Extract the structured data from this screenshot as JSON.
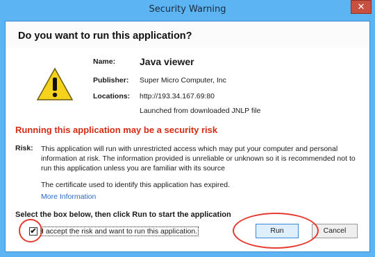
{
  "window": {
    "title": "Security Warning",
    "close_glyph": "✕"
  },
  "dialog": {
    "question": "Do you want to run this application?",
    "icon": "warning-triangle-icon",
    "fields": {
      "name_label": "Name:",
      "name_value": "Java viewer",
      "publisher_label": "Publisher:",
      "publisher_value": "Super Micro Computer, Inc",
      "locations_label": "Locations:",
      "locations_value": "http://193.34.167.69:80",
      "locations_note": "Launched from downloaded JNLP file"
    },
    "risk_heading": "Running this application may be a security risk",
    "risk_label": "Risk:",
    "risk_text": "This application will run with unrestricted access which may put your computer and personal information at risk. The information provided is unreliable or unknown so it is recommended not to run this application unless you are familiar with its source",
    "cert_text": "The certificate used to identify this application has expired.",
    "more_info": "More Information",
    "instruction": "Select the box below, then click Run to start the application",
    "accept_label": "I accept the risk and want to run this application.",
    "accept_checked": true,
    "check_glyph": "✔",
    "buttons": {
      "run": "Run",
      "cancel": "Cancel"
    }
  },
  "colors": {
    "frame": "#5cb4f2",
    "risk_red": "#d62b14",
    "link_blue": "#2e69c5",
    "annotation_red": "#e63a2f"
  }
}
